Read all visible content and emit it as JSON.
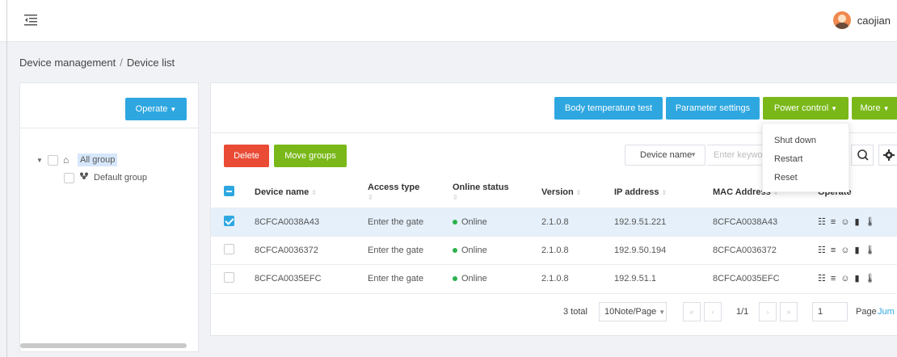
{
  "header": {
    "user_name": "caojian"
  },
  "breadcrumb": {
    "root": "Device management",
    "separator": "/",
    "current": "Device list"
  },
  "left_panel": {
    "operate_label": "Operate",
    "tree": [
      {
        "label": "All group",
        "icon": "home-icon"
      },
      {
        "label": "Default group",
        "icon": "group-icon"
      }
    ]
  },
  "toolbar_top": {
    "body_temp_label": "Body temperature test",
    "param_settings_label": "Parameter settings",
    "power_control_label": "Power control",
    "more_label": "More"
  },
  "power_menu": {
    "items": [
      "Shut down",
      "Restart",
      "Reset"
    ]
  },
  "actions": {
    "delete_label": "Delete",
    "move_groups_label": "Move groups",
    "search_field_label": "Device name",
    "keyword_placeholder": "Enter keywo"
  },
  "table": {
    "headers": {
      "device_name": "Device name",
      "access_type": "Access type",
      "online_status": "Online status",
      "version": "Version",
      "ip_address": "IP address",
      "mac_address": "MAC Address",
      "operate": "Operate"
    },
    "rows": [
      {
        "device_name": "8CFCA0038A43",
        "access_type": "Enter the gate",
        "online_status": "Online",
        "version": "2.1.0.8",
        "ip_address": "192.9.51.221",
        "mac_address": "8CFCA0038A43"
      },
      {
        "device_name": "8CFCA0036372",
        "access_type": "Enter the gate",
        "online_status": "Online",
        "version": "2.1.0.8",
        "ip_address": "192.9.50.194",
        "mac_address": "8CFCA0036372"
      },
      {
        "device_name": "8CFCA0035EFC",
        "access_type": "Enter the gate",
        "online_status": "Online",
        "version": "2.1.0.8",
        "ip_address": "192.9.51.1",
        "mac_address": "8CFCA0035EFC"
      }
    ]
  },
  "pagination": {
    "total": "3 total",
    "page_size": "10Note/Page",
    "first": "«",
    "prev": "‹",
    "page_info": "1/1",
    "next": "›",
    "last": "»",
    "jump_value": "1",
    "page_label": "Page",
    "jump_label": "Jum"
  },
  "colors": {
    "blue": "#2ea7e0",
    "green": "#7ab819",
    "red": "#e94b35",
    "online": "#2bb24c"
  }
}
